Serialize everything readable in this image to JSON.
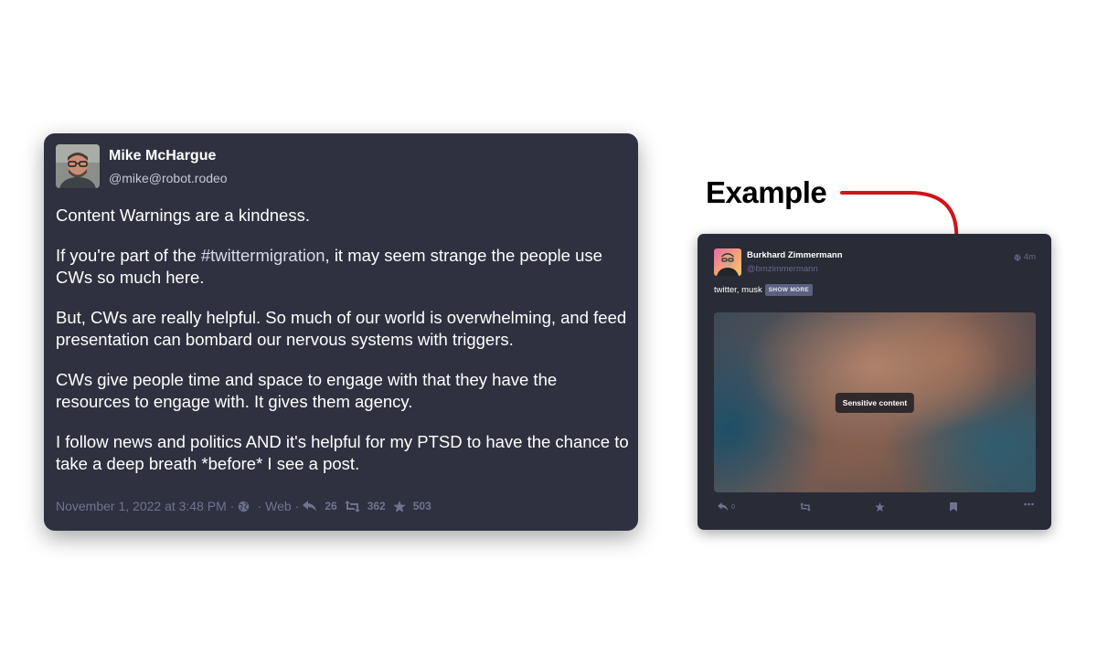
{
  "main_post": {
    "author_name": "Mike McHargue",
    "author_handle": "@mike@robot.rodeo",
    "paragraphs": [
      {
        "before": "Content Warnings are a kindness.",
        "hashtag": "",
        "after": ""
      },
      {
        "before": "If you're part of the ",
        "hashtag": "#twittermigration",
        "after": ", it may seem strange the people use CWs so much here."
      },
      {
        "before": "But, CWs are really helpful. So much of our world is overwhelming, and feed presentation can bombard our nervous systems with triggers.",
        "hashtag": "",
        "after": ""
      },
      {
        "before": "CWs give people time and space to engage with that they have the resources to engage with. It gives them agency.",
        "hashtag": "",
        "after": ""
      },
      {
        "before": "I follow news and politics AND it's helpful for my PTSD to have the chance to take a deep breath *before* I see a post.",
        "hashtag": "",
        "after": ""
      }
    ],
    "timestamp": "November 1, 2022 at 3:48 PM",
    "separator": "·",
    "application": "Web",
    "visibility_icon": "globe-icon",
    "replies_count": "26",
    "boosts_count": "362",
    "favourites_count": "503"
  },
  "example": {
    "label": "Example",
    "arrow_color": "#d0141b",
    "post": {
      "author_name": "Burkhard Zimmermann",
      "author_handle": "@bmzimmermann",
      "time": "4m",
      "cw_text": "twitter, musk",
      "show_more_label": "SHOW MORE",
      "sensitive_label": "Sensitive content",
      "replies_count": "0",
      "actions": [
        "reply-icon",
        "boost-icon",
        "star-icon",
        "bookmark-icon",
        "more-icon"
      ]
    }
  },
  "colors": {
    "card_bg": "#2f3140",
    "mini_card_bg": "#292b37",
    "meta_text": "#6f7390",
    "handle_text": "#c4c7d4"
  }
}
